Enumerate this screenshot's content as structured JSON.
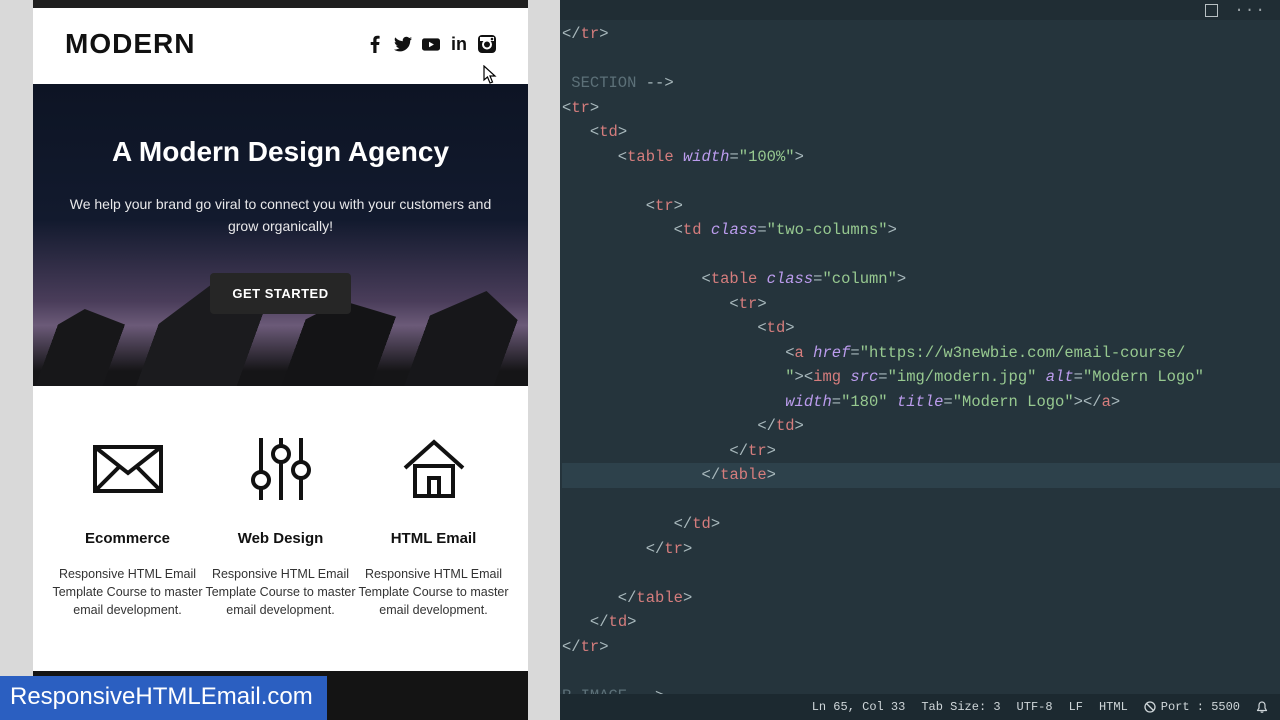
{
  "preview": {
    "logo": "MODERN",
    "hero": {
      "title": "A Modern Design Agency",
      "subtitle": "We help your brand go viral to connect you with your customers and grow organically!",
      "cta": "GET STARTED"
    },
    "features": [
      {
        "title": "Ecommerce",
        "desc": "Responsive HTML Email Template Course to master email development."
      },
      {
        "title": "Web Design",
        "desc": "Responsive HTML Email Template Course to master email development."
      },
      {
        "title": "HTML Email",
        "desc": "Responsive HTML Email Template Course to master email development."
      }
    ],
    "watermark": "ResponsiveHTMLEmail.com"
  },
  "editor": {
    "code_tokens": [
      [
        [
          "punc",
          "</"
        ],
        [
          "tag",
          "tr"
        ],
        [
          "punc",
          ">"
        ]
      ],
      [],
      [
        [
          "cm",
          " SECTION "
        ],
        [
          "punc",
          "-->"
        ]
      ],
      [
        [
          "punc",
          "<"
        ],
        [
          "tag",
          "tr"
        ],
        [
          "punc",
          ">"
        ]
      ],
      [
        [
          "punc",
          "   <"
        ],
        [
          "tag",
          "td"
        ],
        [
          "punc",
          ">"
        ]
      ],
      [
        [
          "punc",
          "      <"
        ],
        [
          "tag",
          "table"
        ],
        [
          "plain",
          " "
        ],
        [
          "attr",
          "width"
        ],
        [
          "punc",
          "="
        ],
        [
          "str",
          "\"100%\""
        ],
        [
          "punc",
          ">"
        ]
      ],
      [],
      [
        [
          "punc",
          "         <"
        ],
        [
          "tag",
          "tr"
        ],
        [
          "punc",
          ">"
        ]
      ],
      [
        [
          "punc",
          "            <"
        ],
        [
          "tag",
          "td"
        ],
        [
          "plain",
          " "
        ],
        [
          "attr",
          "class"
        ],
        [
          "punc",
          "="
        ],
        [
          "str",
          "\"two-columns\""
        ],
        [
          "punc",
          ">"
        ]
      ],
      [],
      [
        [
          "punc",
          "               <"
        ],
        [
          "tag",
          "table"
        ],
        [
          "plain",
          " "
        ],
        [
          "attr",
          "class"
        ],
        [
          "punc",
          "="
        ],
        [
          "str",
          "\"column\""
        ],
        [
          "punc",
          ">"
        ]
      ],
      [
        [
          "punc",
          "                  <"
        ],
        [
          "tag",
          "tr"
        ],
        [
          "punc",
          ">"
        ]
      ],
      [
        [
          "punc",
          "                     <"
        ],
        [
          "tag",
          "td"
        ],
        [
          "punc",
          ">"
        ]
      ],
      [
        [
          "punc",
          "                        <"
        ],
        [
          "tag",
          "a"
        ],
        [
          "plain",
          " "
        ],
        [
          "attr",
          "href"
        ],
        [
          "punc",
          "="
        ],
        [
          "str",
          "\"https://w3newbie.com/email-course/"
        ]
      ],
      [
        [
          "str",
          "                        \""
        ],
        [
          "punc",
          "><"
        ],
        [
          "tag",
          "img"
        ],
        [
          "plain",
          " "
        ],
        [
          "attr",
          "src"
        ],
        [
          "punc",
          "="
        ],
        [
          "str",
          "\"img/modern.jpg\""
        ],
        [
          "plain",
          " "
        ],
        [
          "attr",
          "alt"
        ],
        [
          "punc",
          "="
        ],
        [
          "str",
          "\"Modern Logo\""
        ]
      ],
      [
        [
          "plain",
          "                        "
        ],
        [
          "attr",
          "width"
        ],
        [
          "punc",
          "="
        ],
        [
          "str",
          "\"180\""
        ],
        [
          "plain",
          " "
        ],
        [
          "attr",
          "title"
        ],
        [
          "punc",
          "="
        ],
        [
          "str",
          "\"Modern Logo\""
        ],
        [
          "punc",
          "></"
        ],
        [
          "tag",
          "a"
        ],
        [
          "punc",
          ">"
        ]
      ],
      [
        [
          "punc",
          "                     </"
        ],
        [
          "tag",
          "td"
        ],
        [
          "punc",
          ">"
        ]
      ],
      [
        [
          "punc",
          "                  </"
        ],
        [
          "tag",
          "tr"
        ],
        [
          "punc",
          ">"
        ]
      ],
      [
        [
          "punc",
          "               </"
        ],
        [
          "tag",
          "table"
        ],
        [
          "punc",
          ">"
        ]
      ],
      [],
      [
        [
          "punc",
          "            </"
        ],
        [
          "tag",
          "td"
        ],
        [
          "punc",
          ">"
        ]
      ],
      [
        [
          "punc",
          "         </"
        ],
        [
          "tag",
          "tr"
        ],
        [
          "punc",
          ">"
        ]
      ],
      [],
      [
        [
          "punc",
          "      </"
        ],
        [
          "tag",
          "table"
        ],
        [
          "punc",
          ">"
        ]
      ],
      [
        [
          "punc",
          "   </"
        ],
        [
          "tag",
          "td"
        ],
        [
          "punc",
          ">"
        ]
      ],
      [
        [
          "punc",
          "</"
        ],
        [
          "tag",
          "tr"
        ],
        [
          "punc",
          ">"
        ]
      ],
      [],
      [
        [
          "cm",
          "R IMAGE "
        ],
        [
          "punc",
          "-->"
        ]
      ]
    ],
    "highlight_line_index": 18,
    "status": {
      "line_col": "Ln 65, Col 33",
      "tab_size": "Tab Size: 3",
      "encoding": "UTF-8",
      "eol": "LF",
      "language": "HTML",
      "port": "Port : 5500"
    }
  }
}
